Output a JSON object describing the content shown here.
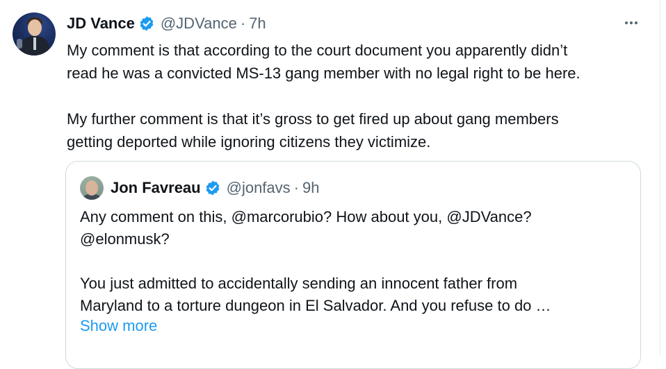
{
  "tweet": {
    "author_name": "JD Vance",
    "handle": "@JDVance",
    "separator": "·",
    "time": "7h",
    "text_para1_line1": "My comment is that according to the court document you apparently didn’t",
    "text_para1_line2": "read he was a convicted MS-13 gang member with no legal right to be here.",
    "text_para2_line1": "My further comment is that it’s gross to get fired up about gang members",
    "text_para2_line2": "getting deported while ignoring citizens they victimize."
  },
  "quoted_tweet": {
    "author_name": "Jon Favreau",
    "handle": "@jonfavs",
    "separator": "·",
    "time": "9h",
    "text_line1": "Any comment on this, @marcorubio? How about you, @JDVance?",
    "text_line2": "@elonmusk?",
    "text_line3": "You just admitted to accidentally sending an innocent father from",
    "text_line4": "Maryland to a torture dungeon in El Salvador. And you refuse to do …",
    "show_more_label": "Show more"
  },
  "icons": {
    "verified": "verified-badge-icon",
    "more": "more-options-icon"
  },
  "colors": {
    "text": "#0f1419",
    "secondary": "#536471",
    "accent": "#1d9bf0",
    "border": "#cfd9de"
  }
}
